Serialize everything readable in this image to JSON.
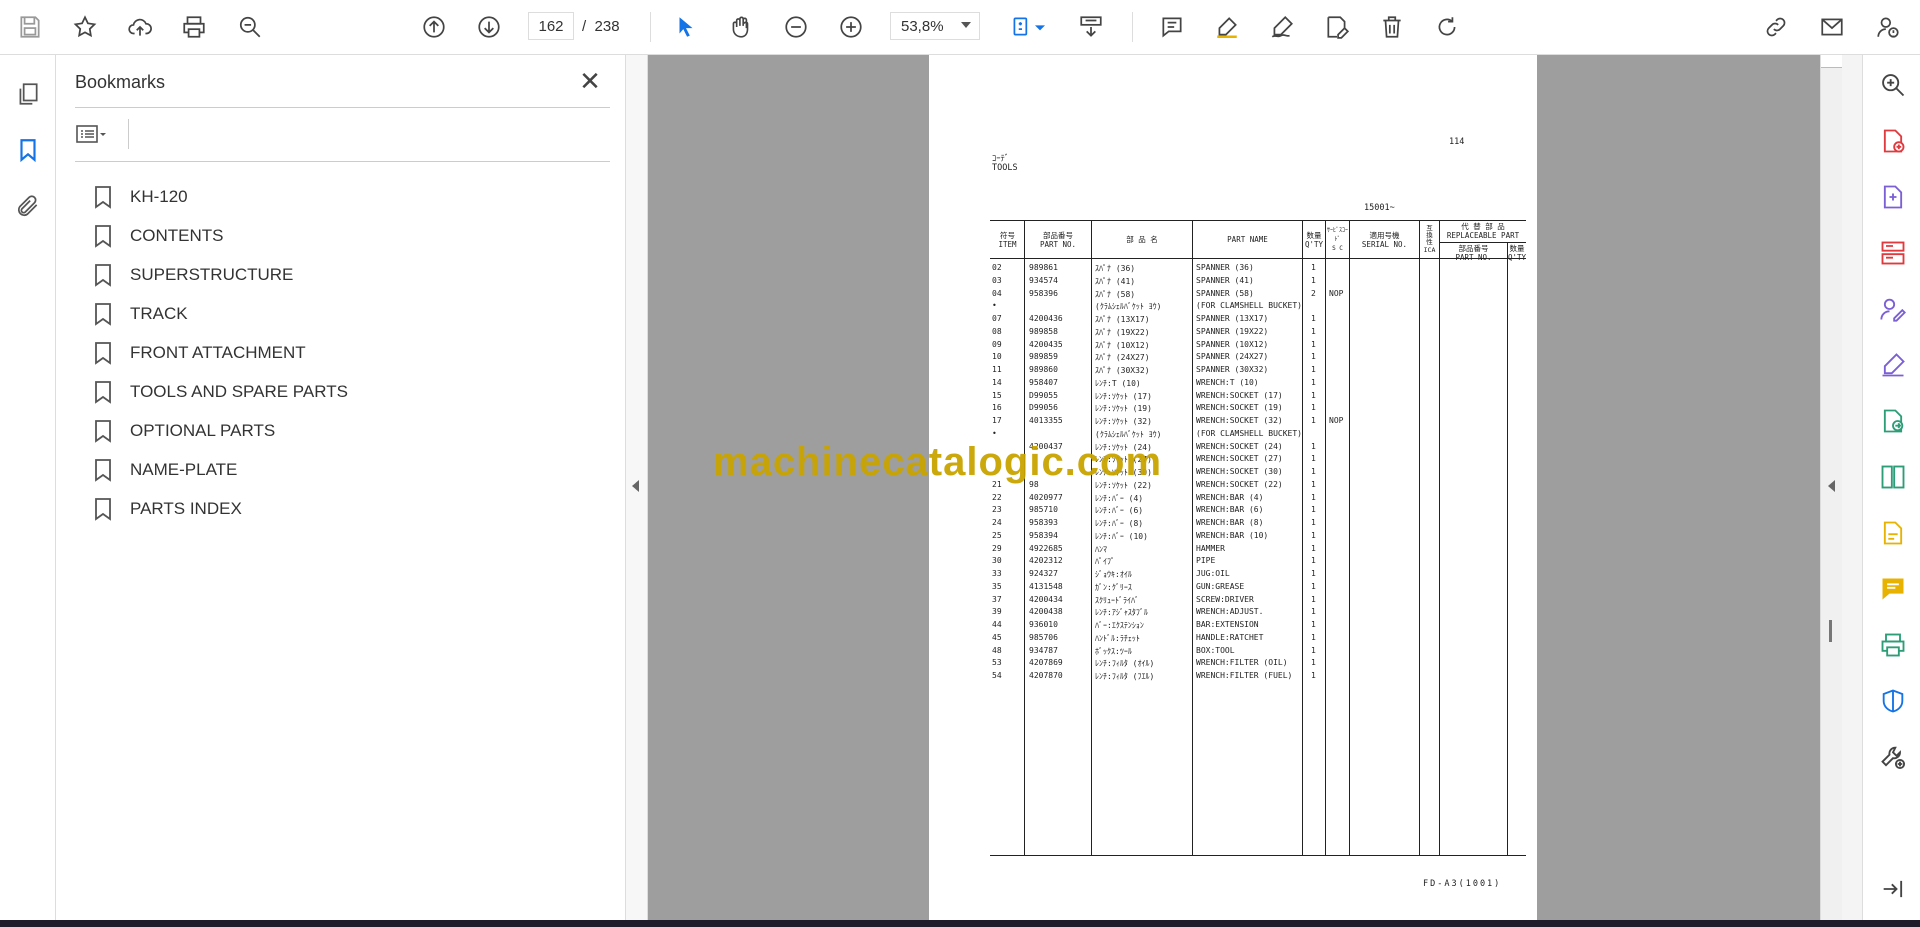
{
  "toolbar": {
    "current_page": "162",
    "page_separator": "/",
    "total_pages": "238",
    "zoom_level": "53,8%"
  },
  "bookmarks": {
    "title": "Bookmarks",
    "items": [
      {
        "label": "KH-120"
      },
      {
        "label": "CONTENTS"
      },
      {
        "label": "SUPERSTRUCTURE"
      },
      {
        "label": "TRACK"
      },
      {
        "label": "FRONT ATTACHMENT"
      },
      {
        "label": "TOOLS AND SPARE PARTS"
      },
      {
        "label": "OPTIONAL PARTS"
      },
      {
        "label": "NAME-PLATE"
      },
      {
        "label": "PARTS INDEX"
      }
    ]
  },
  "document": {
    "page_number": "114",
    "section_jp": "ｺｰﾃﾞ",
    "section_title": "TOOLS",
    "serial_range": "15001~",
    "footer": "FD-A3(1001)",
    "watermark": "machinecatalogic.com",
    "headers": {
      "item_jp": "符号",
      "item": "ITEM",
      "partno_jp": "部品番号",
      "partno": "PART NO.",
      "name_jp": "部 品 名",
      "part_name": "PART NAME",
      "qty_jp": "数量",
      "qty": "Q'TY",
      "sc_jp": "ｻｰﾋﾞｽｺｰﾄﾞ",
      "sc": "S C",
      "serial_jp": "適用号機",
      "serial": "SERIAL NO.",
      "ica_jp": "互換性",
      "ica": "ICA",
      "replaceable_jp": "代 替 部 品",
      "replaceable": "REPLACEABLE PART",
      "rep_partno_jp": "部品番号",
      "rep_partno": "PART NO.",
      "rep_qty_jp": "数量",
      "rep_qty": "Q'TY"
    },
    "rows": [
      {
        "item": "02",
        "part_no": "989861",
        "name_jp": "ｽﾊﾟﾅ (36)",
        "part_name": "SPANNER (36)",
        "qty": "1",
        "sc": ""
      },
      {
        "item": "03",
        "part_no": "934574",
        "name_jp": "ｽﾊﾟﾅ (41)",
        "part_name": "SPANNER (41)",
        "qty": "1",
        "sc": ""
      },
      {
        "item": "04",
        "part_no": "958396",
        "name_jp": "ｽﾊﾟﾅ (58)",
        "part_name": "SPANNER (58)",
        "qty": "2",
        "sc": "NOP"
      },
      {
        "item": "•",
        "part_no": "",
        "name_jp": "(ｸﾗﾑｼｪﾙﾊﾞｹｯﾄ ﾖｳ)",
        "part_name": "(FOR CLAMSHELL BUCKET)",
        "qty": "",
        "sc": ""
      },
      {
        "item": "07",
        "part_no": "4200436",
        "name_jp": "ｽﾊﾟﾅ (13X17)",
        "part_name": "SPANNER (13X17)",
        "qty": "1",
        "sc": ""
      },
      {
        "item": "08",
        "part_no": "989858",
        "name_jp": "ｽﾊﾟﾅ (19X22)",
        "part_name": "SPANNER (19X22)",
        "qty": "1",
        "sc": ""
      },
      {
        "item": "09",
        "part_no": "4200435",
        "name_jp": "ｽﾊﾟﾅ (10X12)",
        "part_name": "SPANNER (10X12)",
        "qty": "1",
        "sc": ""
      },
      {
        "item": "10",
        "part_no": "989859",
        "name_jp": "ｽﾊﾟﾅ (24X27)",
        "part_name": "SPANNER (24X27)",
        "qty": "1",
        "sc": ""
      },
      {
        "item": "11",
        "part_no": "989860",
        "name_jp": "ｽﾊﾟﾅ (30X32)",
        "part_name": "SPANNER (30X32)",
        "qty": "1",
        "sc": ""
      },
      {
        "item": "14",
        "part_no": "958407",
        "name_jp": "ﾚﾝﾁ:T (10)",
        "part_name": "WRENCH:T (10)",
        "qty": "1",
        "sc": ""
      },
      {
        "item": "15",
        "part_no": "D99055",
        "name_jp": "ﾚﾝﾁ:ｿｹｯﾄ (17)",
        "part_name": "WRENCH:SOCKET (17)",
        "qty": "1",
        "sc": ""
      },
      {
        "item": "16",
        "part_no": "D99056",
        "name_jp": "ﾚﾝﾁ:ｿｹｯﾄ (19)",
        "part_name": "WRENCH:SOCKET (19)",
        "qty": "1",
        "sc": ""
      },
      {
        "item": "17",
        "part_no": "4013355",
        "name_jp": "ﾚﾝﾁ:ｿｹｯﾄ (32)",
        "part_name": "WRENCH:SOCKET (32)",
        "qty": "1",
        "sc": "NOP"
      },
      {
        "item": "•",
        "part_no": "",
        "name_jp": "(ｸﾗﾑｼｪﾙﾊﾞｹｯﾄ ﾖｳ)",
        "part_name": "(FOR CLAMSHELL BUCKET)",
        "qty": "",
        "sc": ""
      },
      {
        "item": "",
        "part_no": "4200437",
        "name_jp": "ﾚﾝﾁ:ｿｹｯﾄ (24)",
        "part_name": "WRENCH:SOCKET (24)",
        "qty": "1",
        "sc": ""
      },
      {
        "item": "",
        "part_no": "",
        "name_jp": "ﾚﾝﾁ:ｿｹｯﾄ (27)",
        "part_name": "WRENCH:SOCKET (27)",
        "qty": "1",
        "sc": ""
      },
      {
        "item": "",
        "part_no": "",
        "name_jp": "ﾚﾝﾁ:ｿｹｯﾄ (30)",
        "part_name": "WRENCH:SOCKET (30)",
        "qty": "1",
        "sc": ""
      },
      {
        "item": "21",
        "part_no": "98",
        "name_jp": "ﾚﾝﾁ:ｿｹｯﾄ (22)",
        "part_name": "WRENCH:SOCKET (22)",
        "qty": "1",
        "sc": ""
      },
      {
        "item": "22",
        "part_no": "4020977",
        "name_jp": "ﾚﾝﾁ:ﾊﾞｰ (4)",
        "part_name": "WRENCH:BAR (4)",
        "qty": "1",
        "sc": ""
      },
      {
        "item": "23",
        "part_no": "985710",
        "name_jp": "ﾚﾝﾁ:ﾊﾞｰ (6)",
        "part_name": "WRENCH:BAR (6)",
        "qty": "1",
        "sc": ""
      },
      {
        "item": "24",
        "part_no": "958393",
        "name_jp": "ﾚﾝﾁ:ﾊﾞｰ (8)",
        "part_name": "WRENCH:BAR (8)",
        "qty": "1",
        "sc": ""
      },
      {
        "item": "25",
        "part_no": "958394",
        "name_jp": "ﾚﾝﾁ:ﾊﾞｰ (10)",
        "part_name": "WRENCH:BAR (10)",
        "qty": "1",
        "sc": ""
      },
      {
        "item": "29",
        "part_no": "4922685",
        "name_jp": "ﾊﾝﾏ",
        "part_name": "HAMMER",
        "qty": "1",
        "sc": ""
      },
      {
        "item": "30",
        "part_no": "4202312",
        "name_jp": "ﾊﾟｲﾌﾟ",
        "part_name": "PIPE",
        "qty": "1",
        "sc": ""
      },
      {
        "item": "33",
        "part_no": "924327",
        "name_jp": "ｼﾞｮｳｷ:ｵｲﾙ",
        "part_name": "JUG:OIL",
        "qty": "1",
        "sc": ""
      },
      {
        "item": "35",
        "part_no": "4131548",
        "name_jp": "ｶﾞﾝ:ｸﾞﾘｰｽ",
        "part_name": "GUN:GREASE",
        "qty": "1",
        "sc": ""
      },
      {
        "item": "37",
        "part_no": "4200434",
        "name_jp": "ｽｸﾘｭｰﾄﾞﾗｲﾊﾞ",
        "part_name": "SCREW:DRIVER",
        "qty": "1",
        "sc": ""
      },
      {
        "item": "39",
        "part_no": "4200438",
        "name_jp": "ﾚﾝﾁ:ｱｼﾞｬｽﾀﾌﾞﾙ",
        "part_name": "WRENCH:ADJUST.",
        "qty": "1",
        "sc": ""
      },
      {
        "item": "44",
        "part_no": "936010",
        "name_jp": "ﾊﾞｰ:ｴｸｽﾃﾝｼｮﾝ",
        "part_name": "BAR:EXTENSION",
        "qty": "1",
        "sc": ""
      },
      {
        "item": "45",
        "part_no": "985706",
        "name_jp": "ﾊﾝﾄﾞﾙ:ﾗﾁｪｯﾄ",
        "part_name": "HANDLE:RATCHET",
        "qty": "1",
        "sc": ""
      },
      {
        "item": "48",
        "part_no": "934787",
        "name_jp": "ﾎﾞｯｸｽ:ﾂｰﾙ",
        "part_name": "BOX:TOOL",
        "qty": "1",
        "sc": ""
      },
      {
        "item": "53",
        "part_no": "4207869",
        "name_jp": "ﾚﾝﾁ:ﾌｨﾙﾀ (ｵｲﾙ)",
        "part_name": "WRENCH:FILTER (OIL)",
        "qty": "1",
        "sc": ""
      },
      {
        "item": "54",
        "part_no": "4207870",
        "name_jp": "ﾚﾝﾁ:ﾌｨﾙﾀ (ﾌｴﾙ)",
        "part_name": "WRENCH:FILTER (FUEL)",
        "qty": "1",
        "sc": ""
      }
    ]
  },
  "colors": {
    "watermark": "#c9a400",
    "viewer_bg": "#9e9e9e",
    "accent_blue": "#1473e6",
    "accent_red": "#e03a3e",
    "accent_purple": "#7b5fd6",
    "accent_green": "#2d9d78",
    "accent_yellow": "#e8b300"
  }
}
